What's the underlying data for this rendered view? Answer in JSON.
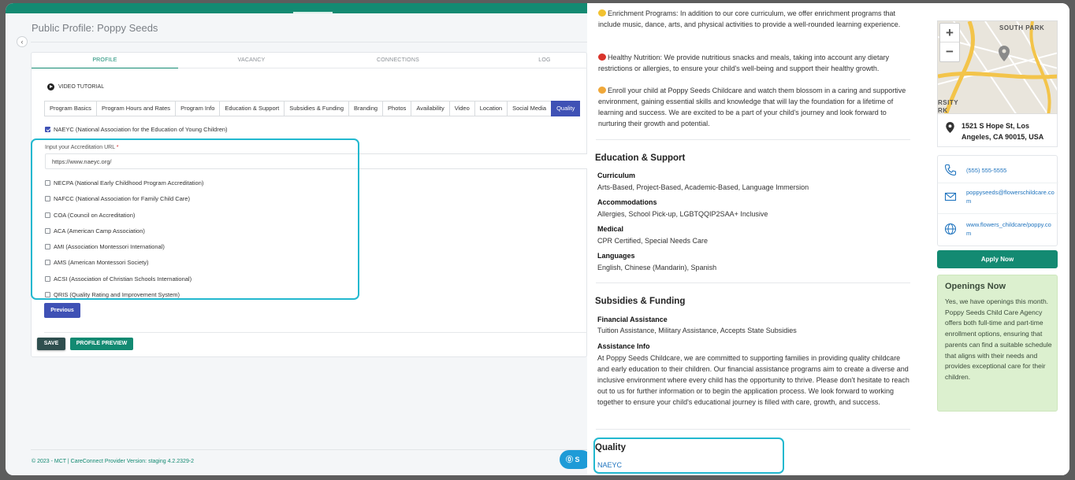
{
  "page_title": "Public Profile: Poppy Seeds",
  "main_tabs": [
    {
      "label": "PROFILE"
    },
    {
      "label": "VACANCY"
    },
    {
      "label": "CONNECTIONS"
    },
    {
      "label": "LOG"
    }
  ],
  "video_tutorial": "VIDEO TUTORIAL",
  "sub_tabs": [
    {
      "label": "Program Basics"
    },
    {
      "label": "Program Hours and Rates"
    },
    {
      "label": "Program Info"
    },
    {
      "label": "Education & Support"
    },
    {
      "label": "Subsidies & Funding"
    },
    {
      "label": "Branding"
    },
    {
      "label": "Photos"
    },
    {
      "label": "Availability"
    },
    {
      "label": "Video"
    },
    {
      "label": "Location"
    },
    {
      "label": "Social Media"
    },
    {
      "label": "Quality"
    }
  ],
  "accreditations": {
    "naeyc": "NAEYC (National Association for the Education of Young Children)",
    "url_label": "Input your Accreditation URL",
    "url_required_mark": "*",
    "url_value": "https://www.naeyc.org/",
    "others": [
      "NECPA (National Early Childhood Program Accreditation)",
      "NAFCC (National Association for Family Child Care)",
      "COA (Council on Accreditation)",
      "ACA (American Camp Association)",
      "AMI (Association Montessori International)",
      "AMS (American Montessori Society)",
      "ACSI (Association of Christian Schools International)",
      "QRIS (Quality Rating and Improvement System)"
    ]
  },
  "buttons": {
    "previous": "Previous",
    "save": "SAVE",
    "profile_preview": "PROFILE PREVIEW",
    "fab": "S"
  },
  "footer": "© 2023 - MCT | CareConnect Provider Version: staging 4.2.2329-2",
  "preview": {
    "enrichment": "Enrichment Programs: In addition to our core curriculum, we offer enrichment programs that include music, dance, arts, and physical activities to provide a well-rounded learning experience.",
    "nutrition": "Healthy Nutrition: We provide nutritious snacks and meals, taking into account any dietary restrictions or allergies, to ensure your child's well-being and support their healthy growth.",
    "enroll": "Enroll your child at Poppy Seeds Childcare and watch them blossom in a caring and supportive environment, gaining essential skills and knowledge that will lay the foundation for a lifetime of learning and success. We are excited to be a part of your child's journey and look forward to nurturing their growth and potential.",
    "education_heading": "Education & Support",
    "curriculum_label": "Curriculum",
    "curriculum_value": "Arts-Based, Project-Based, Academic-Based, Language Immersion",
    "accommodations_label": "Accommodations",
    "accommodations_value": "Allergies, School Pick-up, LGBTQQIP2SAA+ Inclusive",
    "medical_label": "Medical",
    "medical_value": "CPR Certified, Special Needs Care",
    "languages_label": "Languages",
    "languages_value": "English, Chinese (Mandarin), Spanish",
    "subsidies_heading": "Subsidies & Funding",
    "financial_label": "Financial Assistance",
    "financial_value": "Tuition Assistance, Military Assistance, Accepts State Subsidies",
    "assistance_label": "Assistance Info",
    "assistance_value": "At Poppy Seeds Childcare, we are committed to supporting families in providing quality childcare and early education to their children. Our financial assistance programs aim to create a diverse and inclusive environment where every child has the opportunity to thrive. Please don't hesitate to reach out to us for further information or to begin the application process. We look forward to working together to ensure your child's educational journey is filled with care, growth, and success.",
    "quality_heading": "Quality",
    "quality_value": "NAEYC"
  },
  "sidebar": {
    "map_label_1": "SOUTH PARK",
    "map_label_2": "RSITY",
    "map_label_3": "RK",
    "zoom_in": "+",
    "zoom_out": "−",
    "address": "1521 S Hope St, Los Angeles, CA 90015, USA",
    "phone": "(555) 555-5555",
    "email": "poppyseeds@flowerschildcare.com",
    "website": "www.flowers_childcare/poppy.com",
    "apply": "Apply Now",
    "openings_title": "Openings Now",
    "openings_text": "Yes, we have openings this month.\nPoppy Seeds Child Care Agency offers both full-time and part-time enrollment options, ensuring that parents can find a suitable schedule that aligns with their needs and provides exceptional care for their children."
  },
  "colors": {
    "brand_green": "#138a72",
    "tab_blue": "#3f51b5",
    "highlight_cyan": "#22b8cf",
    "link_blue": "#1e73be",
    "openings_bg": "#dcf0cf"
  },
  "icons": {
    "play": "play-circle-icon",
    "pin": "map-pin-icon",
    "phone": "phone-icon",
    "email": "envelope-icon",
    "web": "globe-icon"
  }
}
